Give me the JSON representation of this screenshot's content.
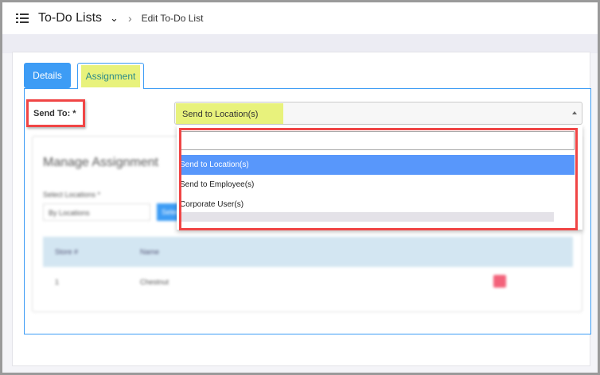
{
  "header": {
    "title": "To-Do Lists",
    "breadcrumb": "Edit To-Do List"
  },
  "tabs": [
    {
      "label": "Details"
    },
    {
      "label": "Assignment"
    }
  ],
  "form": {
    "send_to_label": "Send To: *",
    "send_to_value": "Send to Location(s)"
  },
  "dropdown": {
    "search_value": "",
    "options": [
      "Send to Location(s)",
      "Send to Employee(s)",
      "Corporate User(s)"
    ],
    "selected_index": 0
  },
  "background": {
    "title": "Manage Assignment",
    "select_label": "Select Locations *",
    "select_value": "By Locations",
    "button": "Select",
    "columns": [
      "Store #",
      "Name"
    ],
    "rows": [
      {
        "store": "1",
        "name": "Chestnut"
      }
    ]
  }
}
